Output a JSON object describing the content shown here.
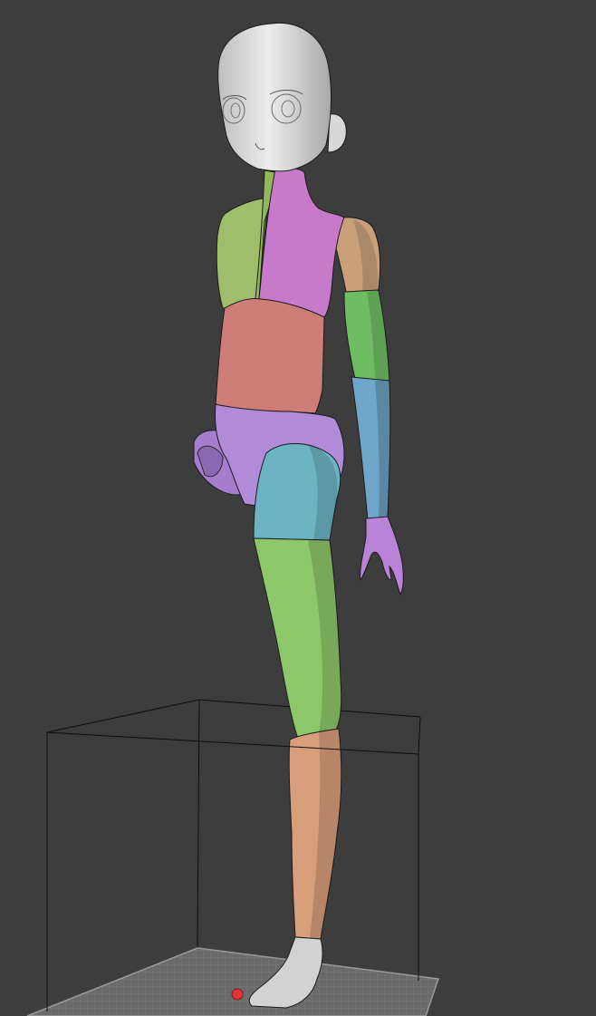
{
  "viewport": {
    "background": "#3d3d3d"
  },
  "build_volume": {
    "frame_color": "#0e0e0e",
    "plate_color": "#6a6a6a",
    "plate_grid_color": "#848484"
  },
  "origin_marker": {
    "color": "#e8323a"
  },
  "model": {
    "parts": [
      {
        "name": "head",
        "color": "#d8d8d8"
      },
      {
        "name": "neck-front",
        "color": "#92b85a"
      },
      {
        "name": "chest-left",
        "color": "#9fbe6c"
      },
      {
        "name": "chest-right",
        "color": "#c77ac9"
      },
      {
        "name": "upper-arm",
        "color": "#c9a07a"
      },
      {
        "name": "forearm-upper",
        "color": "#6fbd63"
      },
      {
        "name": "forearm-lower",
        "color": "#6ea6c9"
      },
      {
        "name": "hand",
        "color": "#b983d8"
      },
      {
        "name": "waist",
        "color": "#cf7d78"
      },
      {
        "name": "pelvis",
        "color": "#b18ad8"
      },
      {
        "name": "thigh-upper",
        "color": "#6cb4c4"
      },
      {
        "name": "thigh-lower",
        "color": "#8cc769"
      },
      {
        "name": "shin",
        "color": "#d89d7a"
      },
      {
        "name": "foot",
        "color": "#d2d2d2"
      }
    ]
  }
}
